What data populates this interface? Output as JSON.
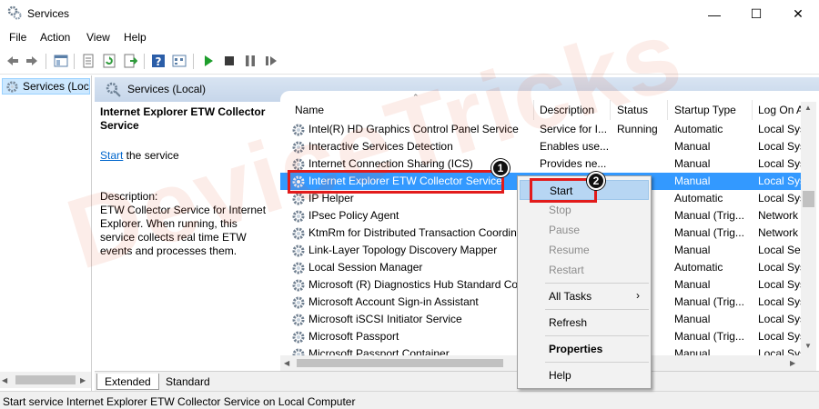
{
  "window": {
    "title": "Services"
  },
  "menu": [
    "File",
    "Action",
    "View",
    "Help"
  ],
  "tree": {
    "node": "Services (Local)"
  },
  "header": {
    "label": "Services (Local)"
  },
  "detail": {
    "title": "Internet Explorer ETW Collector Service",
    "start_link": "Start",
    "start_suffix": " the service",
    "desc_label": "Description:",
    "desc_text": "ETW Collector Service for Internet Explorer. When running, this service collects real time ETW events and processes them."
  },
  "columns": [
    "Name",
    "Description",
    "Status",
    "Startup Type",
    "Log On As"
  ],
  "rows": [
    {
      "name": "Intel(R) HD Graphics Control Panel Service",
      "description": "Service for I...",
      "status": "Running",
      "startup": "Automatic",
      "logon": "Local Syst"
    },
    {
      "name": "Interactive Services Detection",
      "description": "Enables use...",
      "status": "",
      "startup": "Manual",
      "logon": "Local Syst"
    },
    {
      "name": "Internet Connection Sharing (ICS)",
      "description": "Provides ne...",
      "status": "",
      "startup": "Manual",
      "logon": "Local Syst"
    },
    {
      "name": "Internet Explorer ETW Collector Service",
      "description": "",
      "status": "",
      "startup": "Manual",
      "logon": "Local Syst"
    },
    {
      "name": "IP Helper",
      "description": "",
      "status": "",
      "startup": "Automatic",
      "logon": "Local Syst"
    },
    {
      "name": "IPsec Policy Agent",
      "description": "",
      "status": "",
      "startup": "Manual (Trig...",
      "logon": "Network S"
    },
    {
      "name": "KtmRm for Distributed Transaction Coordinator",
      "description": "",
      "status": "",
      "startup": "Manual (Trig...",
      "logon": "Network S"
    },
    {
      "name": "Link-Layer Topology Discovery Mapper",
      "description": "",
      "status": "",
      "startup": "Manual",
      "logon": "Local Serv"
    },
    {
      "name": "Local Session Manager",
      "description": "",
      "status": "",
      "startup": "Automatic",
      "logon": "Local Syst"
    },
    {
      "name": "Microsoft (R) Diagnostics Hub Standard Collector Service",
      "description": "",
      "status": "",
      "startup": "Manual",
      "logon": "Local Syst"
    },
    {
      "name": "Microsoft Account Sign-in Assistant",
      "description": "",
      "status": "",
      "startup": "Manual (Trig...",
      "logon": "Local Syst"
    },
    {
      "name": "Microsoft iSCSI Initiator Service",
      "description": "",
      "status": "",
      "startup": "Manual",
      "logon": "Local Syst"
    },
    {
      "name": "Microsoft Passport",
      "description": "",
      "status": "",
      "startup": "Manual (Trig...",
      "logon": "Local Syst"
    },
    {
      "name": "Microsoft Passport Container",
      "description": "",
      "status": "",
      "startup": "Manual",
      "logon": "Local Syst"
    }
  ],
  "context_menu": {
    "start": "Start",
    "stop": "Stop",
    "pause": "Pause",
    "resume": "Resume",
    "restart": "Restart",
    "all_tasks": "All Tasks",
    "refresh": "Refresh",
    "properties": "Properties",
    "help": "Help"
  },
  "callouts": {
    "one": "1",
    "two": "2"
  },
  "tabs": {
    "extended": "Extended",
    "standard": "Standard"
  },
  "status": "Start service Internet Explorer ETW Collector Service on Local Computer",
  "watermark": "DeviceTricks",
  "colors": {
    "selection": "#3399ff",
    "callout_red": "#e21b1b",
    "link": "#0066cc"
  },
  "icons": [
    "gear-icon",
    "back-icon",
    "forward-icon",
    "play-icon",
    "stop-icon",
    "pause-icon",
    "restart-icon",
    "help-icon"
  ]
}
